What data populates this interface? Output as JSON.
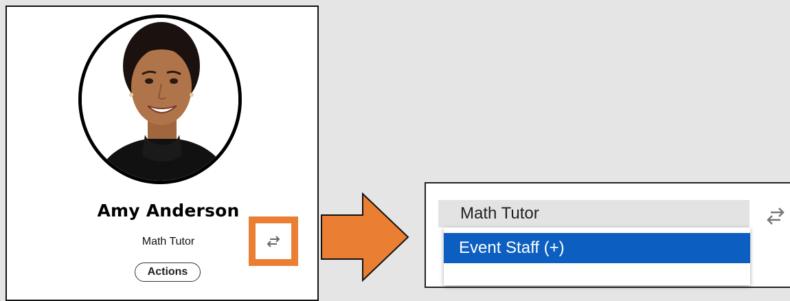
{
  "profile": {
    "name": "Amy Anderson",
    "role": "Math Tutor",
    "actions_label": "Actions",
    "avatar_icon": "person-photo",
    "swap_icon": "swap-arrows-icon"
  },
  "highlight_color": "#ea7f33",
  "dropdown": {
    "selected_value": "Math Tutor",
    "options": [
      {
        "label": "Event Staff (+)",
        "highlighted": true
      }
    ],
    "highlight_color": "#0c5fc0"
  }
}
